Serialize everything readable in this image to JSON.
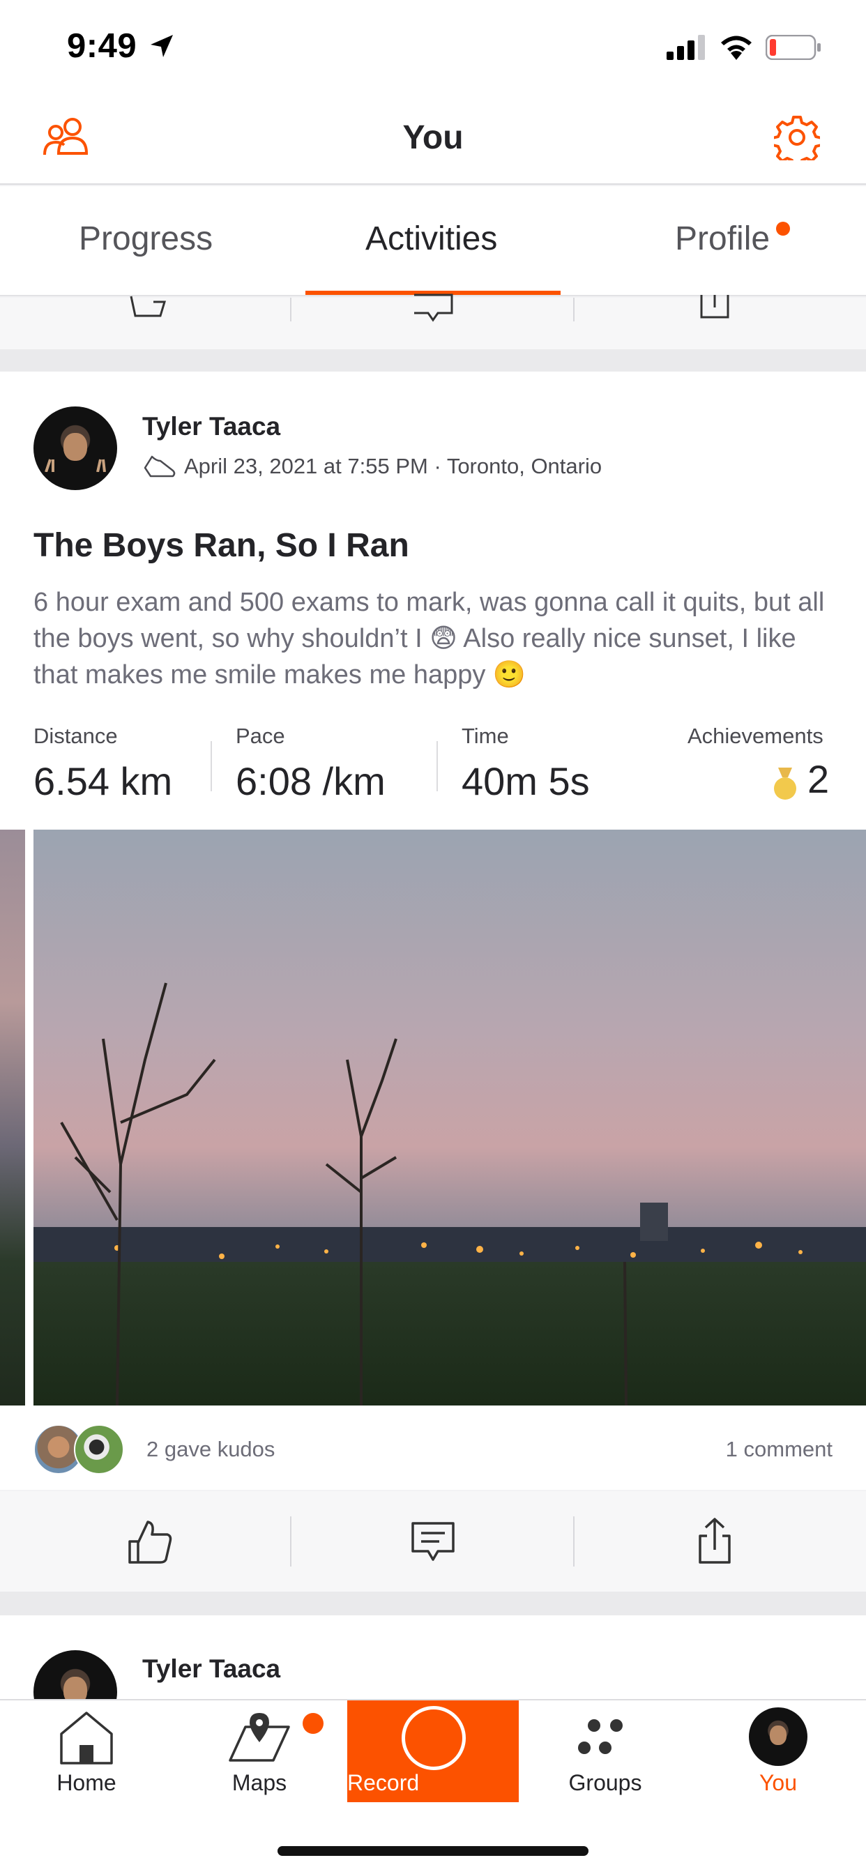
{
  "status_bar": {
    "time": "9:49"
  },
  "header": {
    "title": "You"
  },
  "tabs": [
    {
      "label": "Progress"
    },
    {
      "label": "Activities",
      "active": true
    },
    {
      "label": "Profile",
      "has_notification": true
    }
  ],
  "activity": {
    "author": "Tyler Taaca",
    "meta": "April 23, 2021 at 7:55 PM · Toronto, Ontario",
    "title": "The Boys Ran, So I Ran",
    "description": "6 hour exam and 500 exams to mark, was gonna call it quits, but all the boys went, so why shouldn’t I 😨 Also really nice sunset, I like that makes me smile makes me happy 🙂",
    "stats": [
      {
        "label": "Distance",
        "value": "6.54 km"
      },
      {
        "label": "Pace",
        "value": "6:08 /km"
      },
      {
        "label": "Time",
        "value": "40m 5s"
      }
    ],
    "achievements": {
      "label": "Achievements",
      "value": "2"
    },
    "kudos_text": "2 gave kudos",
    "comment_text": "1 comment"
  },
  "next_activity": {
    "author": "Tyler Taaca"
  },
  "bottom_nav": [
    {
      "label": "Home"
    },
    {
      "label": "Maps",
      "has_notification": true
    },
    {
      "label": "Record"
    },
    {
      "label": "Groups"
    },
    {
      "label": "You",
      "active": true
    }
  ],
  "colors": {
    "accent": "#fc5200",
    "text": "#242428",
    "muted": "#6d6d78"
  }
}
